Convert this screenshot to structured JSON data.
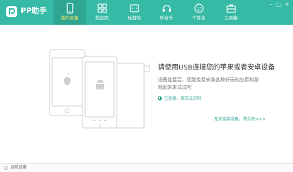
{
  "app": {
    "title": "PP助手",
    "brand_color": "#36b9a5"
  },
  "window_controls": [
    "minimize",
    "maximize",
    "close"
  ],
  "nav": [
    {
      "label": "我的设备",
      "icon": "device-icon",
      "active": true
    },
    {
      "label": "找应用",
      "icon": "apps-icon",
      "active": false
    },
    {
      "label": "玩游戏",
      "icon": "gamepad-icon",
      "active": false
    },
    {
      "label": "听音乐",
      "icon": "music-icon",
      "active": false
    },
    {
      "label": "个性化",
      "icon": "personalize-icon",
      "active": false
    },
    {
      "label": "工具箱",
      "icon": "toolbox-icon",
      "active": false
    }
  ],
  "main": {
    "title": "请使用USB连接您的苹果或者安卓设备",
    "description": "设备连接后，您能免费安装各种好玩的应用和游戏起来来试试吧",
    "notice": "已连接，但无法识别",
    "help_link": "无法连接设备，请点击>>>"
  },
  "status": {
    "text": "当前设备"
  }
}
